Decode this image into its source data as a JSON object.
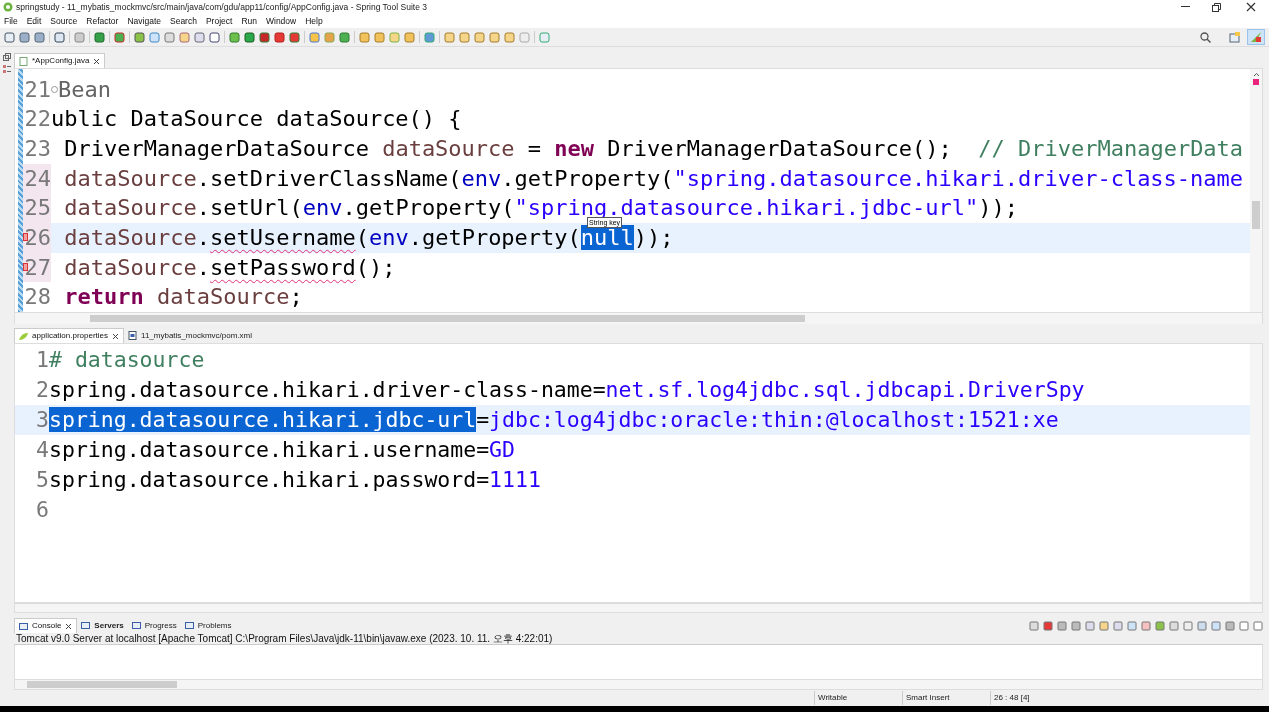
{
  "window": {
    "title": "springstudy - 11_mybatis_mockmvc/src/main/java/com/gdu/app11/config/AppConfig.java - Spring Tool Suite 3"
  },
  "menu": [
    "File",
    "Edit",
    "Source",
    "Refactor",
    "Navigate",
    "Search",
    "Project",
    "Run",
    "Window",
    "Help"
  ],
  "java_editor": {
    "tabs": [
      {
        "label": "*AppConfig.java",
        "selected": true
      }
    ],
    "lines": [
      {
        "number": "21",
        "current": false,
        "changed": false,
        "error": false,
        "tokens": [
          {
            "text": "Bean",
            "kind": "annotation"
          }
        ]
      },
      {
        "number": "22",
        "current": false,
        "changed": false,
        "error": false,
        "tokens": [
          {
            "text": "ublic DataSource dataSource() {",
            "kind": "plain"
          }
        ]
      },
      {
        "number": "23",
        "current": false,
        "changed": false,
        "error": false,
        "tokens": [
          {
            "text": " DriverManagerDataSource ",
            "kind": "plain"
          },
          {
            "text": "dataSource",
            "kind": "field"
          },
          {
            "text": " = ",
            "kind": "plain"
          },
          {
            "text": "new",
            "kind": "keyword"
          },
          {
            "text": " DriverManagerDataSource();  ",
            "kind": "plain"
          },
          {
            "text": "// DriverManagerData",
            "kind": "comment"
          }
        ]
      },
      {
        "number": "24",
        "current": false,
        "changed": true,
        "error": false,
        "tokens": [
          {
            "text": " dataSource",
            "kind": "field"
          },
          {
            "text": ".setDriverClassName(",
            "kind": "plain"
          },
          {
            "text": "env",
            "kind": "member"
          },
          {
            "text": ".getProperty(",
            "kind": "plain"
          },
          {
            "text": "\"spring.datasource.hikari.driver-class-name",
            "kind": "string"
          }
        ]
      },
      {
        "number": "25",
        "current": false,
        "changed": true,
        "error": false,
        "tokens": [
          {
            "text": " dataSource",
            "kind": "field"
          },
          {
            "text": ".setUrl(",
            "kind": "plain"
          },
          {
            "text": "env",
            "kind": "member"
          },
          {
            "text": ".getProperty(",
            "kind": "plain"
          },
          {
            "text": "\"spring.datasource.hikari.jdbc-url\"",
            "kind": "string"
          },
          {
            "text": "));",
            "kind": "plain"
          }
        ]
      },
      {
        "number": "26",
        "current": true,
        "changed": true,
        "error": true,
        "tokens": [
          {
            "text": " dataSource",
            "kind": "field"
          },
          {
            "text": ".",
            "kind": "plain"
          },
          {
            "text": "setUsername",
            "kind": "error"
          },
          {
            "text": "(",
            "kind": "plain"
          },
          {
            "text": "env",
            "kind": "member"
          },
          {
            "text": ".getProperty(",
            "kind": "plain"
          },
          {
            "text": "null",
            "kind": "selected"
          },
          {
            "text": "));",
            "kind": "plain"
          }
        ]
      },
      {
        "number": "27",
        "current": false,
        "changed": true,
        "error": true,
        "tokens": [
          {
            "text": " dataSource",
            "kind": "field"
          },
          {
            "text": ".",
            "kind": "plain"
          },
          {
            "text": "setPassword",
            "kind": "error"
          },
          {
            "text": "();",
            "kind": "plain"
          }
        ]
      },
      {
        "number": "28",
        "current": false,
        "changed": false,
        "error": false,
        "tokens": [
          {
            "text": " return",
            "kind": "keyword"
          },
          {
            "text": " dataSource",
            "kind": "field"
          },
          {
            "text": ";",
            "kind": "plain"
          }
        ]
      }
    ],
    "tooltip": "String key"
  },
  "properties_editor": {
    "tabs": [
      {
        "label": "application.properties",
        "selected": true,
        "closable": true,
        "kind": "properties"
      },
      {
        "label": "11_mybatis_mockmvc/pom.xml",
        "selected": false,
        "closable": false,
        "kind": "xml"
      }
    ],
    "lines": [
      {
        "number": "1",
        "current": false,
        "tokens": [
          {
            "text": "# datasource",
            "kind": "comment"
          }
        ]
      },
      {
        "number": "2",
        "current": false,
        "tokens": [
          {
            "text": "spring.datasource.hikari.driver-class-name",
            "kind": "key"
          },
          {
            "text": "=",
            "kind": "key"
          },
          {
            "text": "net.sf.log4jdbc.sql.jdbcapi.DriverSpy",
            "kind": "value"
          }
        ]
      },
      {
        "number": "3",
        "current": true,
        "tokens": [
          {
            "text": "spring.datasource.hikari.jdbc-url",
            "kind": "selected"
          },
          {
            "text": "=",
            "kind": "key"
          },
          {
            "text": "jdbc:log4jdbc:oracle:thin:@localhost:1521:xe",
            "kind": "value"
          }
        ]
      },
      {
        "number": "4",
        "current": false,
        "tokens": [
          {
            "text": "spring.datasource.hikari.username",
            "kind": "key"
          },
          {
            "text": "=",
            "kind": "key"
          },
          {
            "text": "GD",
            "kind": "value"
          }
        ]
      },
      {
        "number": "5",
        "current": false,
        "tokens": [
          {
            "text": "spring.datasource.hikari.password",
            "kind": "key"
          },
          {
            "text": "=",
            "kind": "key"
          },
          {
            "text": "1111",
            "kind": "value"
          }
        ]
      },
      {
        "number": "6",
        "current": false
      }
    ]
  },
  "console": {
    "tabs": [
      {
        "label": "Console",
        "selected": true,
        "closable": true
      },
      {
        "label": "Servers",
        "selected": false,
        "closable": false
      },
      {
        "label": "Progress",
        "selected": false,
        "closable": false
      },
      {
        "label": "Problems",
        "selected": false,
        "closable": false
      }
    ],
    "description": "Tomcat v9.0 Server at localhost [Apache Tomcat] C:\\Program Files\\Java\\jdk-11\\bin\\javaw.exe  (2023. 10. 11. 오후 4:22:01)"
  },
  "status_bar": [
    "Writable",
    "Smart Insert",
    "26 : 48 [4]"
  ]
}
